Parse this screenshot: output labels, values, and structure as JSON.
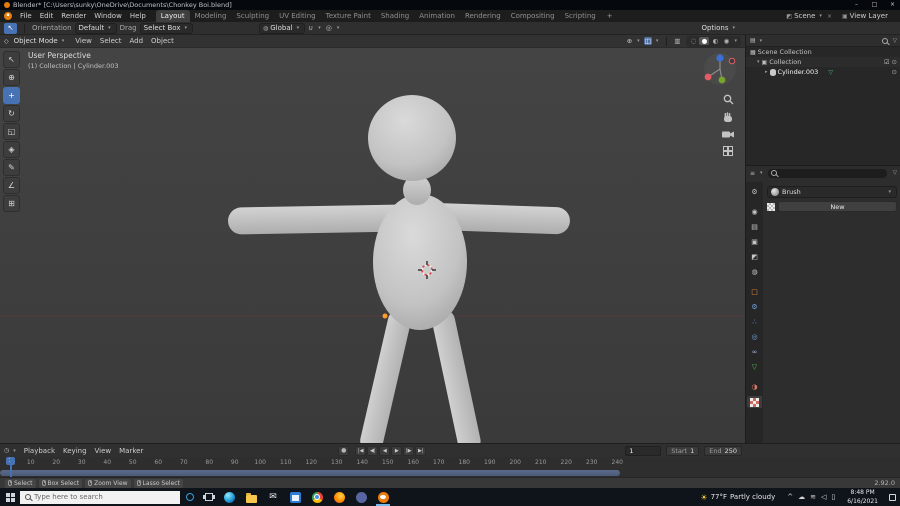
{
  "colors": {
    "accent": "#4772b3",
    "blender_orange": "#e87d0d"
  },
  "title_bar": {
    "title": "Blender* [C:\\Users\\sunky\\OneDrive\\Documents\\Chonkey Boi.blend]"
  },
  "menu_bar": {
    "menus": [
      "File",
      "Edit",
      "Render",
      "Window",
      "Help"
    ],
    "workspaces": [
      "Layout",
      "Modeling",
      "Sculpting",
      "UV Editing",
      "Texture Paint",
      "Shading",
      "Animation",
      "Rendering",
      "Compositing",
      "Scripting"
    ],
    "active_workspace": "Layout",
    "add_workspace": "+",
    "scene_label": "Scene",
    "view_layer_label": "View Layer"
  },
  "tool_settings": {
    "orientation_label": "Orientation",
    "orientation_value": "Default",
    "drag_label": "Drag",
    "drag_value": "Select Box",
    "transform_orientation": "Global",
    "options_label": "Options"
  },
  "viewport": {
    "mode": "Object Mode",
    "menus": [
      "View",
      "Select",
      "Add",
      "Object"
    ],
    "overlay": {
      "line1": "User Perspective",
      "line2": "(1) Collection | Cylinder.003"
    },
    "toolbar_tools": [
      "select-box",
      "cursor",
      "move",
      "rotate",
      "scale",
      "transform",
      "annotate",
      "measure",
      "add-cube"
    ],
    "active_tool": "move",
    "shading_modes": [
      "wireframe",
      "solid",
      "material-preview",
      "rendered"
    ],
    "active_shading": "solid"
  },
  "outliner": {
    "rows": [
      {
        "label": "Scene Collection",
        "depth": 0
      },
      {
        "label": "Collection",
        "depth": 1
      },
      {
        "label": "Cylinder.003",
        "depth": 2
      }
    ]
  },
  "properties": {
    "tabs": [
      "tool",
      "render",
      "output",
      "view-layer",
      "scene",
      "world",
      "object",
      "modifiers",
      "particles",
      "physics",
      "constraints",
      "object-data",
      "material",
      "texture"
    ],
    "active_tab": "texture",
    "brush_label": "Brush",
    "new_button_label": "New"
  },
  "timeline": {
    "menus": [
      "Playback",
      "Keying",
      "View",
      "Marker"
    ],
    "transport": [
      "jump-to-start",
      "previous-keyframe",
      "play-reverse",
      "play",
      "next-keyframe",
      "jump-to-end"
    ],
    "current_frame": "1",
    "start_label": "Start",
    "start_value": "1",
    "end_label": "End",
    "end_value": "250",
    "ticks": [
      "10",
      "20",
      "30",
      "40",
      "50",
      "60",
      "70",
      "80",
      "90",
      "100",
      "110",
      "120",
      "130",
      "140",
      "150",
      "160",
      "170",
      "180",
      "190",
      "200",
      "210",
      "220",
      "230",
      "240"
    ]
  },
  "status_bar": {
    "hints": [
      "Select",
      "Box Select",
      "Zoom View",
      "Lasso Select"
    ],
    "version": "2.92.0"
  },
  "taskbar": {
    "search_placeholder": "Type here to search",
    "app_icons": [
      "edge",
      "file-explorer",
      "mail",
      "store",
      "chrome",
      "firefox",
      "discord",
      "blender"
    ],
    "weather_temp": "77°F",
    "weather_text": "Partly cloudy",
    "time": "8:48 PM",
    "date": "6/16/2021"
  }
}
